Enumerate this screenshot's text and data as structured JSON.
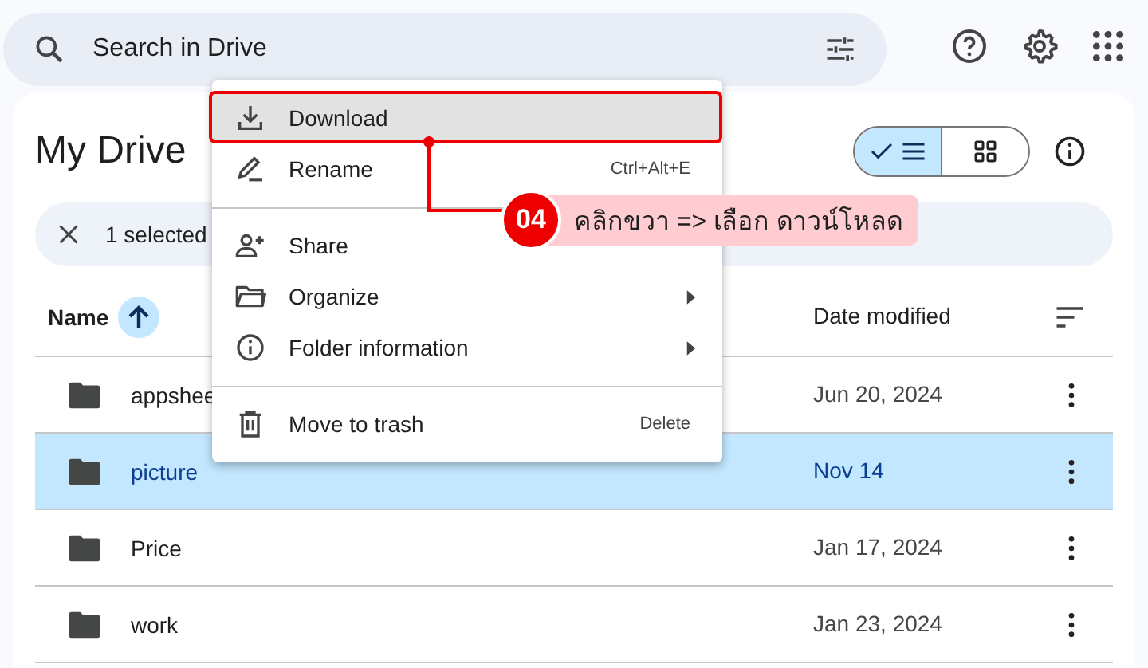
{
  "search": {
    "placeholder": "Search in Drive"
  },
  "title": "My Drive",
  "view_toggle": [
    {
      "kind": "list",
      "selected": true
    },
    {
      "kind": "grid",
      "selected": false
    }
  ],
  "selection_bar": {
    "text": "1 selected"
  },
  "table": {
    "columns": [
      {
        "label": "Name",
        "sorted": true
      },
      {
        "label": "Date modified",
        "sorted": false
      }
    ],
    "rows": [
      {
        "name": "appshee",
        "date": "Jun 20, 2024",
        "selected": false
      },
      {
        "name": "picture",
        "date": "Nov 14",
        "selected": true
      },
      {
        "name": "Price",
        "date": "Jan 17, 2024",
        "selected": false
      },
      {
        "name": "work",
        "date": "Jan 23, 2024",
        "selected": false
      }
    ]
  },
  "context_menu": {
    "items": [
      {
        "kind": "item",
        "label": "Download",
        "selected": true,
        "submenu": false
      },
      {
        "kind": "item",
        "label": "Rename",
        "shortcut": "Ctrl+Alt+E",
        "selected": false,
        "submenu": false
      },
      {
        "kind": "divider"
      },
      {
        "kind": "item",
        "label": "Share",
        "selected": false,
        "submenu": false
      },
      {
        "kind": "item",
        "label": "Organize",
        "selected": false,
        "submenu": true
      },
      {
        "kind": "item",
        "label": "Folder information",
        "selected": false,
        "submenu": true
      },
      {
        "kind": "divider"
      },
      {
        "kind": "item",
        "label": "Move to trash",
        "shortcut": "Delete",
        "selected": false,
        "submenu": false
      }
    ]
  },
  "annotation": {
    "number": "04",
    "text": "คลิกขวา => เลือก ดาวน์โหลด"
  }
}
